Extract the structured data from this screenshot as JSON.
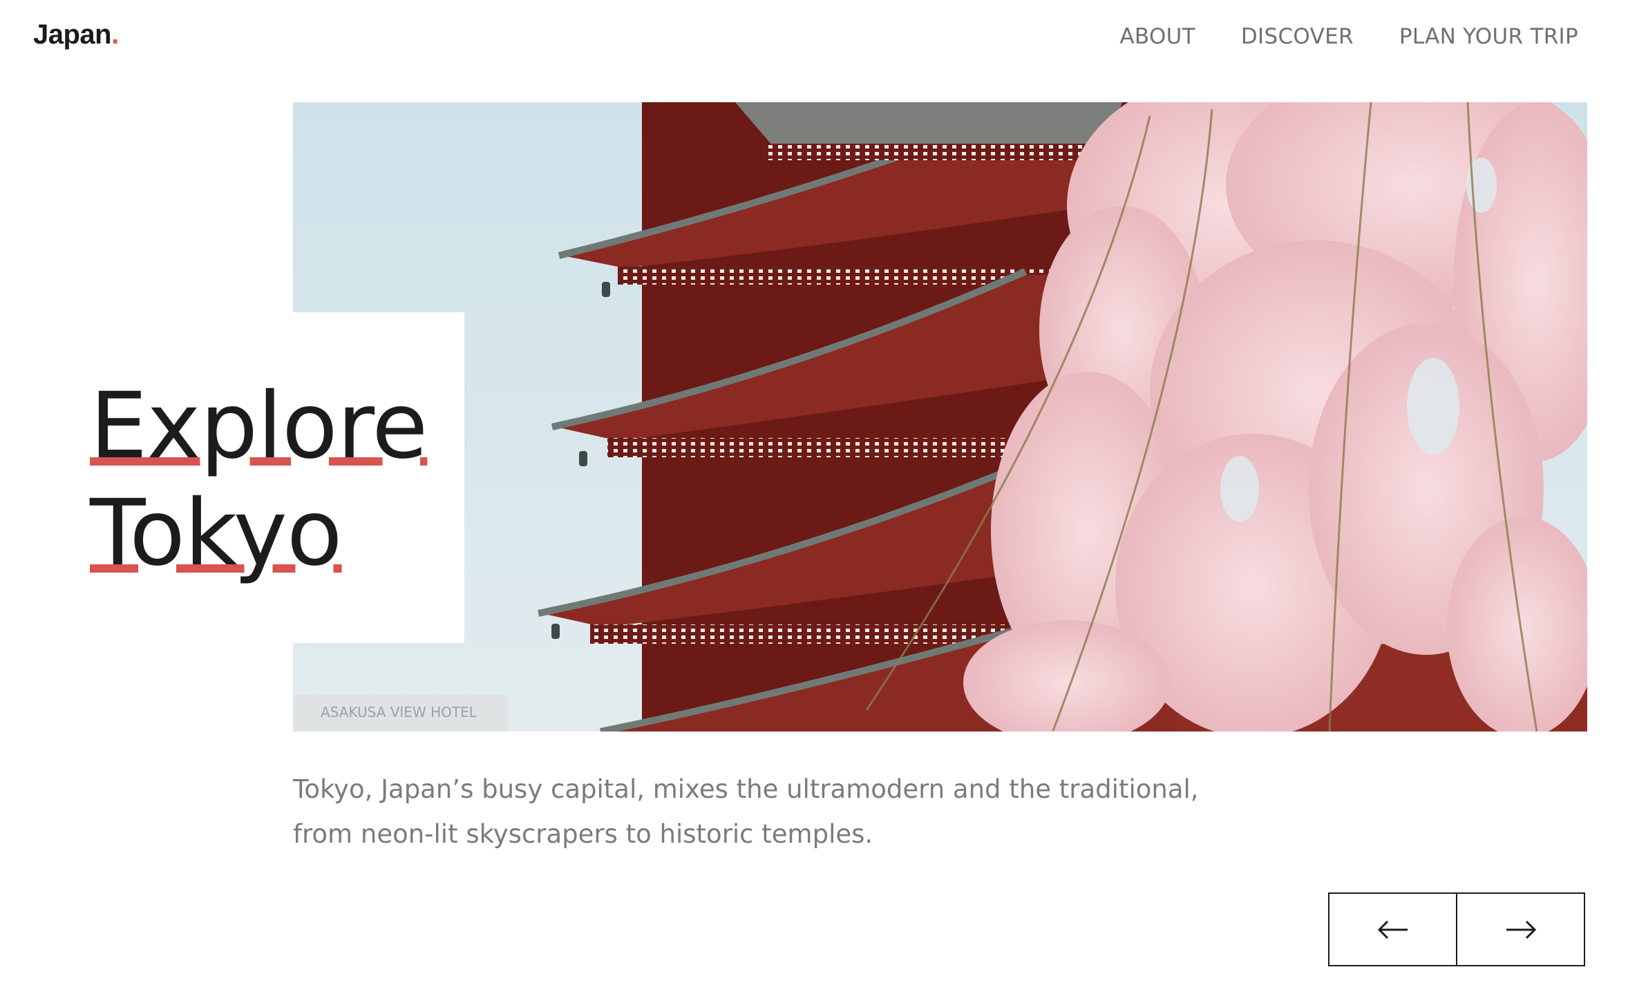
{
  "header": {
    "logo_text": "Japan",
    "logo_dot": ".",
    "nav": [
      {
        "label": "ABOUT"
      },
      {
        "label": "DISCOVER"
      },
      {
        "label": "PLAN YOUR TRIP"
      }
    ]
  },
  "hero": {
    "title_line1": "Explore",
    "title_line2": "Tokyo",
    "image_alt": "Pagoda with cherry blossoms",
    "sign_text": "ASAKUSA VIEW HOTEL",
    "description": "Tokyo, Japan’s busy capital, mixes the ultramodern and the traditional, from neon-lit skyscrapers to historic temples."
  },
  "pager": {
    "prev_icon": "arrow-left-icon",
    "next_icon": "arrow-right-icon"
  },
  "colors": {
    "accent": "#d9534f",
    "text": "#1c1c1c",
    "muted": "#7b7b7b",
    "sky": "#d3e4ea",
    "pagoda": "#7a1f1b",
    "blossom": "#f0c8cd"
  }
}
